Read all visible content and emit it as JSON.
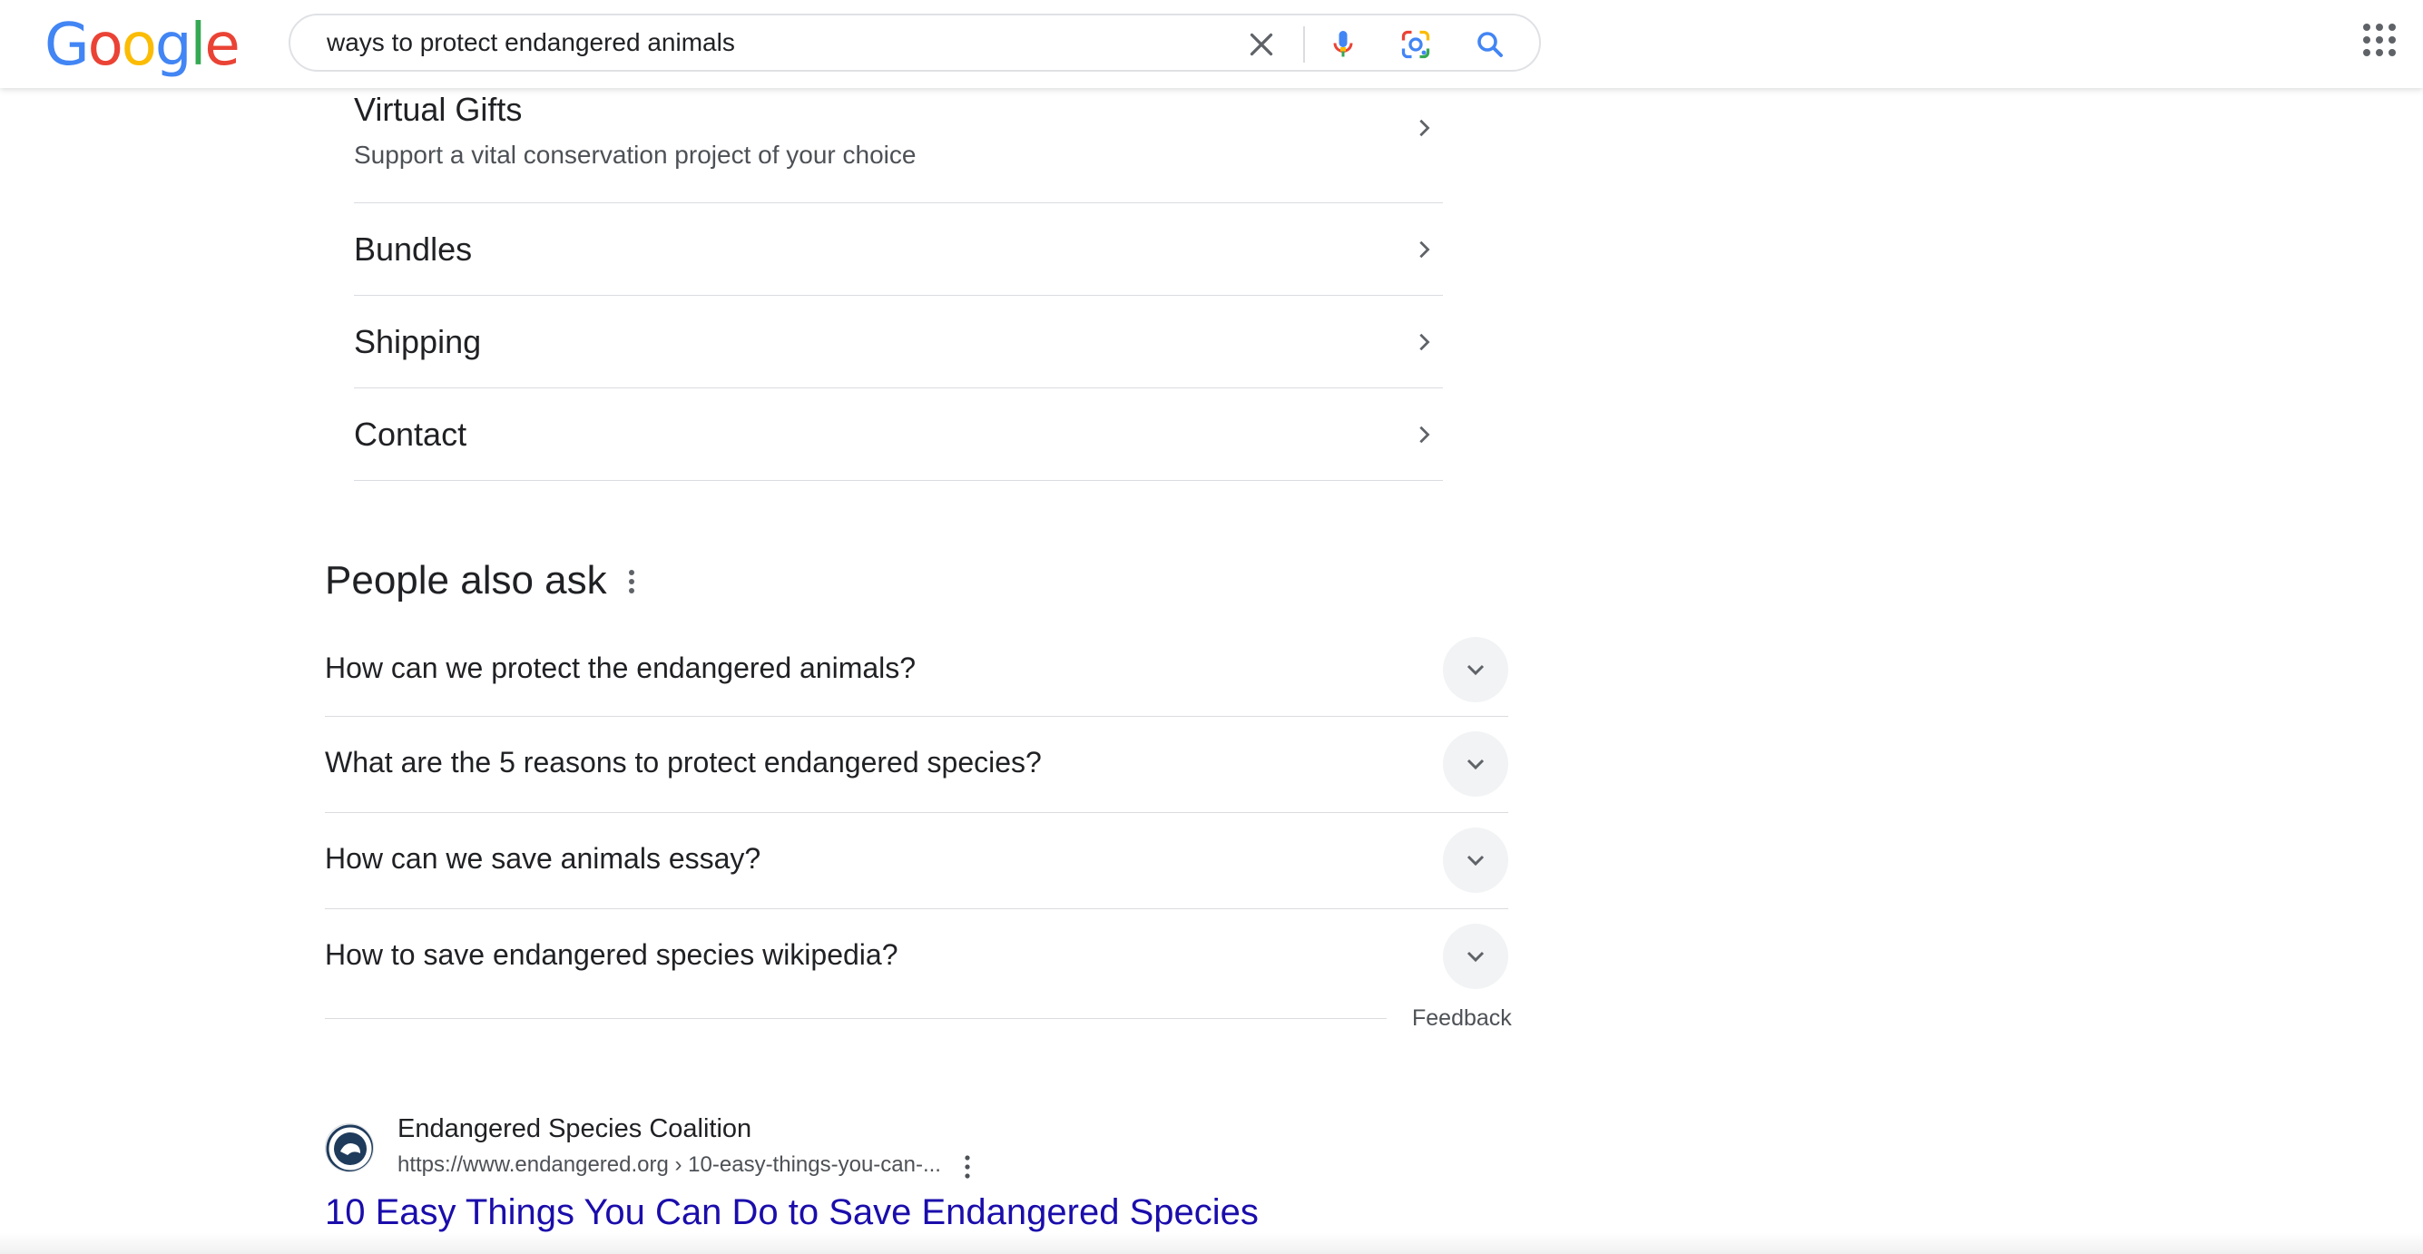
{
  "header": {
    "logo_letters": [
      "G",
      "o",
      "o",
      "g",
      "l",
      "e"
    ],
    "logo_colors": [
      "#4285F4",
      "#EA4335",
      "#FBBC05",
      "#4285F4",
      "#34A853",
      "#EA4335"
    ],
    "search_query": "ways to protect endangered animals",
    "icons": [
      "close-icon",
      "microphone-icon",
      "google-lens-icon",
      "search-icon",
      "apps-grid-icon"
    ]
  },
  "sitelinks": {
    "items": [
      {
        "title": "Virtual Gifts",
        "description": "Support a vital conservation project of your choice"
      },
      {
        "title": "Bundles"
      },
      {
        "title": "Shipping"
      },
      {
        "title": "Contact"
      }
    ]
  },
  "people_also_ask": {
    "title": "People also ask",
    "questions": [
      "How can we protect the endangered animals?",
      "What are the 5 reasons to protect endangered species?",
      "How can we save animals essay?",
      "How to save endangered species wikipedia?"
    ],
    "feedback_label": "Feedback"
  },
  "result": {
    "site_name": "Endangered Species Coalition",
    "url": "https://www.endangered.org › 10-easy-things-you-can-...",
    "title": "10 Easy Things You Can Do to Save Endangered Species"
  },
  "colors": {
    "link_blue": "#1a0dab",
    "text_primary": "#202124",
    "text_secondary": "#4d5156",
    "divider": "#dadce0"
  }
}
